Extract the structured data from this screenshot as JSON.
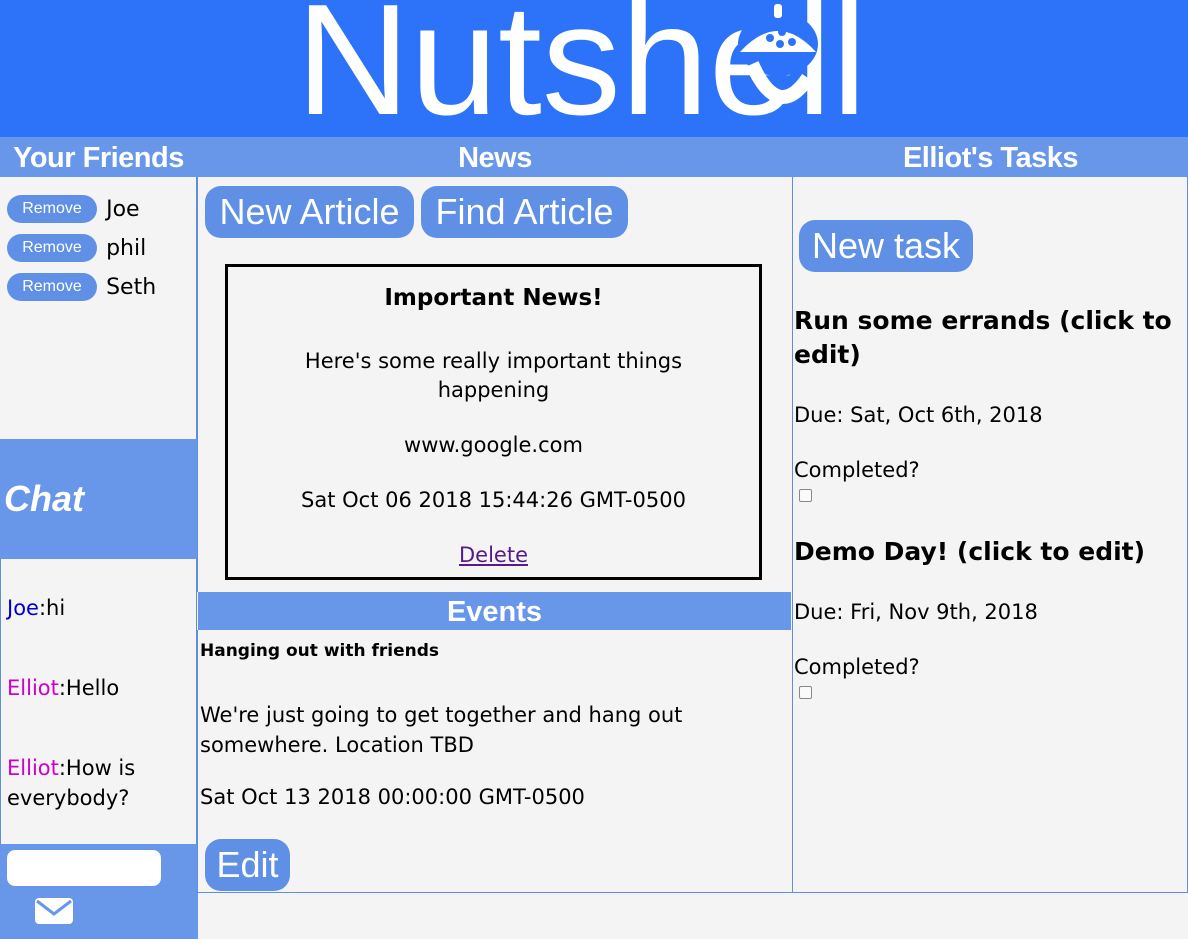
{
  "app": {
    "logo_text": "Nutshell"
  },
  "colors": {
    "header_blue": "#2d73fa",
    "panel_blue": "#6897ea",
    "button_blue": "#5f90e6"
  },
  "columns": {
    "friends_title": "Your Friends",
    "news_title": "News",
    "tasks_title": "Elliot's Tasks"
  },
  "friends": {
    "remove_label": "Remove",
    "items": [
      "Joe",
      "phil",
      "Seth"
    ]
  },
  "chat": {
    "title": "Chat",
    "messages": [
      {
        "user": "Joe",
        "user_color": "#0000cc",
        "text": ":hi"
      },
      {
        "user": "Elliot",
        "user_color": "#cc00cc",
        "text": ":Hello"
      },
      {
        "user": "Elliot",
        "user_color": "#cc00cc",
        "text": ":How is everybody?"
      }
    ],
    "input_value": "",
    "send_icon": "envelope-icon"
  },
  "news": {
    "new_article_label": "New Article",
    "find_article_label": "Find Article",
    "article": {
      "title": "Important News!",
      "body": "Here's some really important things happening",
      "url": "www.google.com",
      "date": "Sat Oct 06 2018 15:44:26 GMT-0500",
      "delete_label": "Delete"
    }
  },
  "events": {
    "title": "Events",
    "event": {
      "name": "Hanging out with friends",
      "description": "We're just going to get together and hang out somewhere. Location TBD",
      "date": "Sat Oct 13 2018 00:00:00 GMT-0500",
      "edit_label": "Edit"
    }
  },
  "tasks": {
    "new_task_label": "New task",
    "completed_label": "Completed?",
    "items": [
      {
        "title": "Run some errands (click to edit)",
        "due": "Due: Sat, Oct 6th, 2018",
        "completed": false
      },
      {
        "title": "Demo Day! (click to edit)",
        "due": "Due: Fri, Nov 9th, 2018",
        "completed": false
      }
    ]
  }
}
